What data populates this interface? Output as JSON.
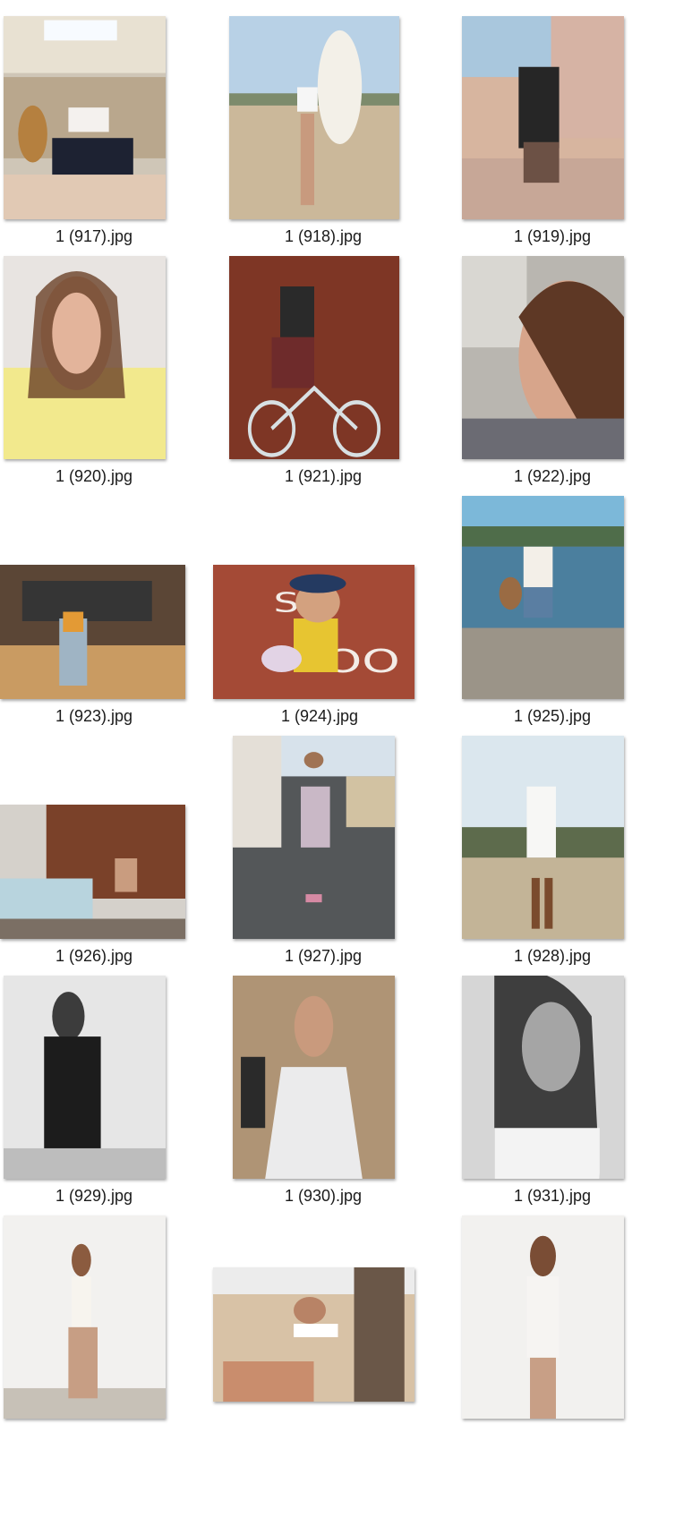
{
  "files": [
    {
      "name": "1 (917).jpg"
    },
    {
      "name": "1 (918).jpg"
    },
    {
      "name": "1 (919).jpg"
    },
    {
      "name": "1 (920).jpg"
    },
    {
      "name": "1 (921).jpg"
    },
    {
      "name": "1 (922).jpg"
    },
    {
      "name": "1 (923).jpg"
    },
    {
      "name": "1 (924).jpg"
    },
    {
      "name": "1 (925).jpg"
    },
    {
      "name": "1 (926).jpg"
    },
    {
      "name": "1 (927).jpg"
    },
    {
      "name": "1 (928).jpg"
    },
    {
      "name": "1 (929).jpg"
    },
    {
      "name": "1 (930).jpg"
    },
    {
      "name": "1 (931).jpg"
    },
    {
      "name": ""
    },
    {
      "name": ""
    },
    {
      "name": ""
    }
  ]
}
